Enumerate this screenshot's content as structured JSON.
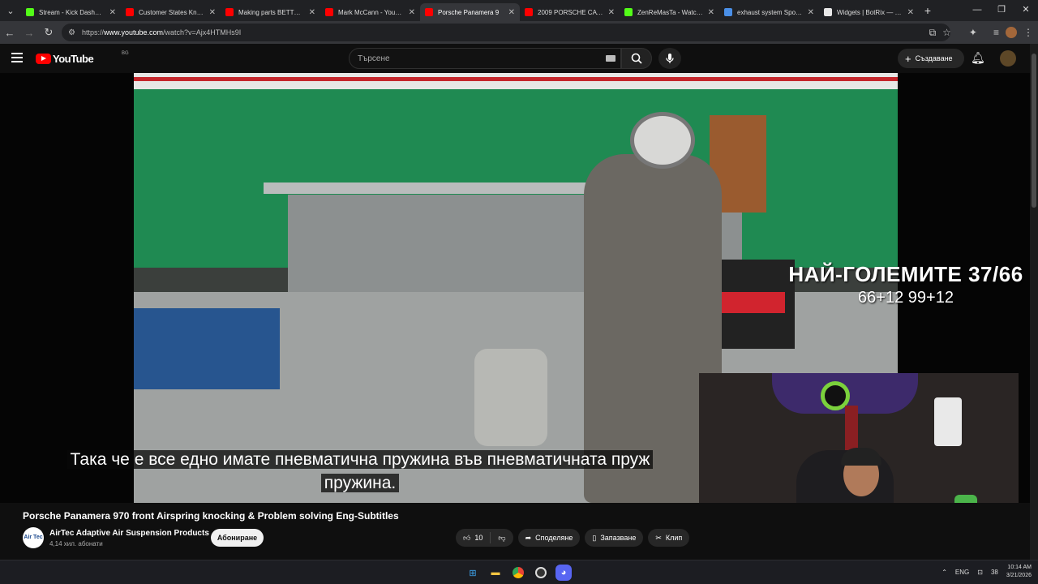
{
  "browser": {
    "tabs": [
      {
        "title": "Stream - Kick Dashboard",
        "color": "#53fc18",
        "active": false
      },
      {
        "title": "Customer States Knocking",
        "color": "#ff0000",
        "active": false
      },
      {
        "title": "Making parts BETTER than",
        "color": "#ff0000",
        "active": false
      },
      {
        "title": "Mark McCann - YouTube",
        "color": "#ff0000",
        "active": false
      },
      {
        "title": "Porsche Panamera 9",
        "color": "#ff0000",
        "active": true
      },
      {
        "title": "2009 PORSCHE CAYENNE",
        "color": "#ff0000",
        "active": false
      },
      {
        "title": "ZenReMasTa - Watch the",
        "color": "#53fc18",
        "active": false
      },
      {
        "title": "exhaust system Sport ve",
        "color": "#4a8fe7",
        "active": false
      },
      {
        "title": "Widgets | BotRix — Clou",
        "color": "#e8e8e8",
        "active": false
      }
    ],
    "url_prefix": "https://",
    "url_host": "www.youtube.com",
    "url_path": "/watch?v=Ajx4HTMHs9I",
    "window_controls": {
      "minimize": "—",
      "maximize": "❐",
      "close": "✕"
    }
  },
  "youtube": {
    "logo_text": "YouTube",
    "country_code": "BG",
    "search_placeholder": "Търсене",
    "create_label": "Създаване"
  },
  "video": {
    "overlay_title": "НАЙ-ГОЛЕМИТЕ 37/66",
    "overlay_sub": "66+12 99+12",
    "subtitle_line1": "Така че е все едно имате пневматична пружина във пневматичната пруж",
    "subtitle_line2": "пружина."
  },
  "meta": {
    "title": "Porsche Panamera 970 front Airspring knocking & Problem solving Eng-Subtitles",
    "channel_name": "AirTec Adaptive Air Suspension Products",
    "channel_avatar_text": "Air Tec",
    "subscribers": "4,14 хил. абонати",
    "subscribe_label": "Абониране",
    "likes": "10",
    "share_label": "Споделяне",
    "save_label": "Запазване",
    "clip_label": "Клип"
  },
  "taskbar": {
    "lang": "ENG",
    "time": "10:14 AM",
    "date": "3/21/2026",
    "badge_count": "38"
  }
}
